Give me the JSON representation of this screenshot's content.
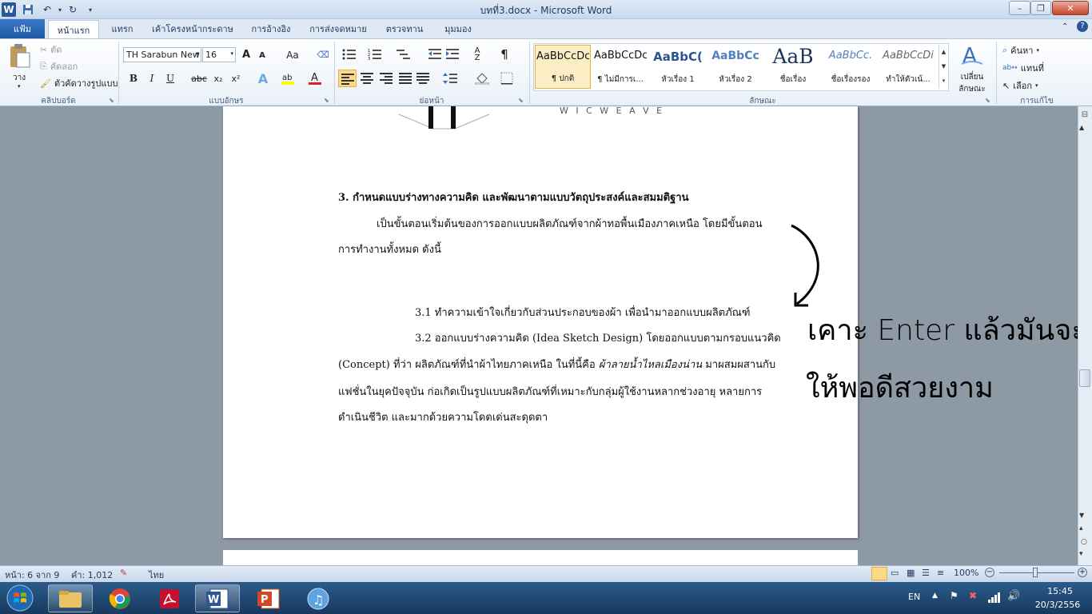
{
  "window": {
    "title": "บทที่3.docx - Microsoft Word",
    "minimize": "–",
    "maximize": "❐",
    "close": "✕"
  },
  "tabs": [
    {
      "label": "แฟ้ม"
    },
    {
      "label": "หน้าแรก"
    },
    {
      "label": "แทรก"
    },
    {
      "label": "เค้าโครงหน้ากระดาษ"
    },
    {
      "label": "การอ้างอิง"
    },
    {
      "label": "การส่งจดหมาย"
    },
    {
      "label": "ตรวจทาน"
    },
    {
      "label": "มุมมอง"
    }
  ],
  "clipboard": {
    "paste": "วาง",
    "cut": "ตัด",
    "copy": "คัดลอก",
    "format_painter": "ตัวคัดวางรูปแบบ",
    "group": "คลิปบอร์ด"
  },
  "font": {
    "name": "TH Sarabun New",
    "size": "16",
    "grow": "A",
    "shrink": "A",
    "case": "Aa",
    "bold": "B",
    "italic": "I",
    "underline": "U",
    "strike": "abc",
    "sub": "x₂",
    "sup": "x²",
    "group": "แบบอักษร"
  },
  "paragraph": {
    "pilcrow": "¶",
    "group": "ย่อหน้า"
  },
  "styles": {
    "group": "ลักษณะ",
    "change": "เปลี่ยน",
    "change2": "ลักษณะ",
    "items": [
      {
        "preview": "AaBbCcDc",
        "name": "¶ ปกติ"
      },
      {
        "preview": "AaBbCcDc",
        "name": "¶ ไม่มีการเ..."
      },
      {
        "preview": "AaBbC(",
        "name": "หัวเรื่อง 1"
      },
      {
        "preview": "AaBbCc",
        "name": "หัวเรื่อง 2"
      },
      {
        "preview": "AaB",
        "name": "ชื่อเรื่อง"
      },
      {
        "preview": "AaBbCc.",
        "name": "ชื่อเรื่องรอง"
      },
      {
        "preview": "AaBbCcDi",
        "name": "ทำให้ตัวเน้..."
      }
    ]
  },
  "editing": {
    "find": "ค้นหา",
    "replace": "แทนที่",
    "select": "เลือก",
    "group": "การแก้ไข"
  },
  "doc": {
    "logo_text": "W I C W E A V E",
    "heading": "3. กำหนดแบบร่างทางความคิด และพัฒนาตามแบบวัตถุประสงค์และสมมติฐาน",
    "p1_line1": "เป็นขั้นตอนเริ่มต้นของการออกแบบผลิตภัณฑ์จากผ้าทอพื้นเมืองภาคเหนือ โดยมีขั้นตอน",
    "p1_line2": "การทำงานทั้งหมด ดังนี้",
    "p31": "3.1 ทำความเข้าใจเกี่ยวกับส่วนประกอบของผ้า เพื่อนำมาออกแบบผลิตภัณฑ์",
    "p32_line1": "3.2 ออกแบบร่างความคิด (Idea Sketch Design) โดยออกแบบตามกรอบแนวคิด",
    "p32_line2a": "(Concept) ที่ว่า ผลิตภัณฑ์ที่นำผ้าไทยภาคเหนือ ในที่นี้คือ ",
    "p32_line2b": "ผ้าลายน้ำไหลเมืองน่าน",
    "p32_line2c": " มาผสมผสานกับ",
    "p32_line3": "แฟชั่นในยุคปัจจุบัน ก่อเกิดเป็นรูปแบบผลิตภัณฑ์ที่เหมาะกับกลุ่มผู้ใช้งานหลากช่วงอายุ หลายการ",
    "p32_line4": "ดำเนินชีวิต และมากด้วยความโดดเด่นสะดุดตา"
  },
  "annotation": {
    "line1": "เคาะ Enter แล้วมันจะจัด",
    "line2": "ให้พอดีสวยงาม"
  },
  "status": {
    "page": "หน้า: 6 จาก 9",
    "words": "คำ: 1,012",
    "lang": "ไทย",
    "zoom": "100%"
  },
  "taskbar": {
    "lang": "EN",
    "time": "15:45",
    "date": "20/3/2556"
  }
}
